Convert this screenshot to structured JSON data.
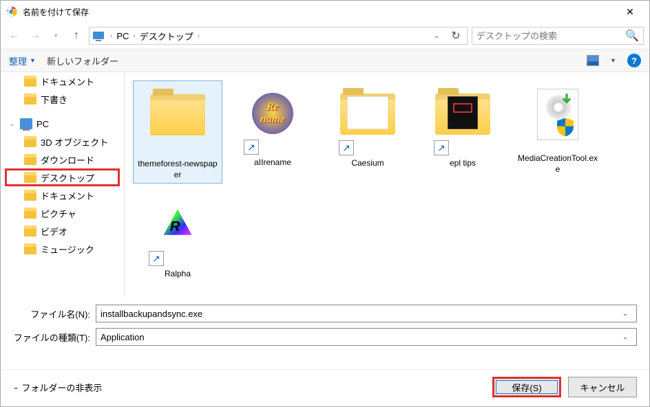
{
  "title": "名前を付けて保存",
  "breadcrumb": {
    "root": "PC",
    "current": "デスクトップ"
  },
  "search": {
    "placeholder": "デスクトップの検索"
  },
  "toolbar": {
    "organize": "整理",
    "newfolder": "新しいフォルダー"
  },
  "sidebar": {
    "items": [
      {
        "label": "ドキュメント"
      },
      {
        "label": "下書き"
      },
      {
        "label": "PC"
      },
      {
        "label": "3D オブジェクト"
      },
      {
        "label": "ダウンロード"
      },
      {
        "label": "デスクトップ"
      },
      {
        "label": "ドキュメント"
      },
      {
        "label": "ピクチャ"
      },
      {
        "label": "ビデオ"
      },
      {
        "label": "ミュージック"
      }
    ]
  },
  "files": [
    {
      "name": "themeforest-newspaper",
      "selected": true,
      "kind": "folder"
    },
    {
      "name": "aIIrename",
      "kind": "app-shortcut"
    },
    {
      "name": "Caesium",
      "kind": "folder-shortcut"
    },
    {
      "name": "epl tips",
      "kind": "folder-shortcut"
    },
    {
      "name": "MediaCreationTool.exe",
      "kind": "exe"
    },
    {
      "name": "Ralpha",
      "kind": "app-shortcut"
    }
  ],
  "form": {
    "filename_label": "ファイル名(N):",
    "filename_value": "installbackupandsync.exe",
    "filetype_label": "ファイルの種類(T):",
    "filetype_value": "Application"
  },
  "footer": {
    "hidefolders": "フォルダーの非表示",
    "save": "保存(S)",
    "cancel": "キャンセル"
  }
}
